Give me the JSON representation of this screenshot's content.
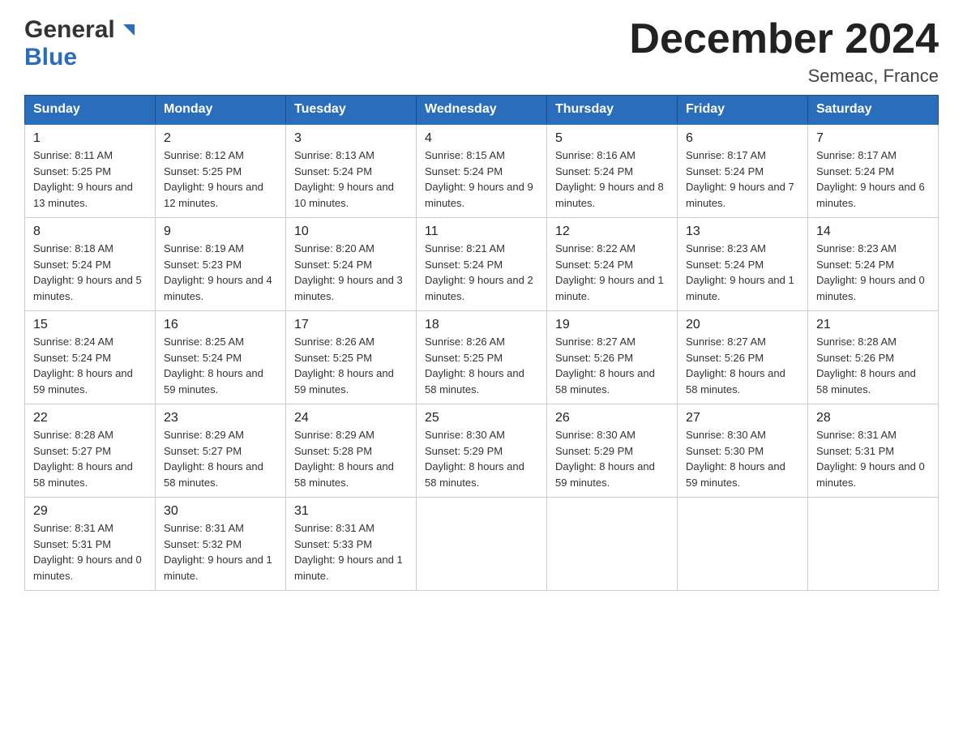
{
  "header": {
    "logo_general": "General",
    "logo_blue": "Blue",
    "month_title": "December 2024",
    "location": "Semeac, France"
  },
  "days_of_week": [
    "Sunday",
    "Monday",
    "Tuesday",
    "Wednesday",
    "Thursday",
    "Friday",
    "Saturday"
  ],
  "weeks": [
    [
      {
        "day": "1",
        "sunrise": "8:11 AM",
        "sunset": "5:25 PM",
        "daylight": "9 hours and 13 minutes."
      },
      {
        "day": "2",
        "sunrise": "8:12 AM",
        "sunset": "5:25 PM",
        "daylight": "9 hours and 12 minutes."
      },
      {
        "day": "3",
        "sunrise": "8:13 AM",
        "sunset": "5:24 PM",
        "daylight": "9 hours and 10 minutes."
      },
      {
        "day": "4",
        "sunrise": "8:15 AM",
        "sunset": "5:24 PM",
        "daylight": "9 hours and 9 minutes."
      },
      {
        "day": "5",
        "sunrise": "8:16 AM",
        "sunset": "5:24 PM",
        "daylight": "9 hours and 8 minutes."
      },
      {
        "day": "6",
        "sunrise": "8:17 AM",
        "sunset": "5:24 PM",
        "daylight": "9 hours and 7 minutes."
      },
      {
        "day": "7",
        "sunrise": "8:17 AM",
        "sunset": "5:24 PM",
        "daylight": "9 hours and 6 minutes."
      }
    ],
    [
      {
        "day": "8",
        "sunrise": "8:18 AM",
        "sunset": "5:24 PM",
        "daylight": "9 hours and 5 minutes."
      },
      {
        "day": "9",
        "sunrise": "8:19 AM",
        "sunset": "5:23 PM",
        "daylight": "9 hours and 4 minutes."
      },
      {
        "day": "10",
        "sunrise": "8:20 AM",
        "sunset": "5:24 PM",
        "daylight": "9 hours and 3 minutes."
      },
      {
        "day": "11",
        "sunrise": "8:21 AM",
        "sunset": "5:24 PM",
        "daylight": "9 hours and 2 minutes."
      },
      {
        "day": "12",
        "sunrise": "8:22 AM",
        "sunset": "5:24 PM",
        "daylight": "9 hours and 1 minute."
      },
      {
        "day": "13",
        "sunrise": "8:23 AM",
        "sunset": "5:24 PM",
        "daylight": "9 hours and 1 minute."
      },
      {
        "day": "14",
        "sunrise": "8:23 AM",
        "sunset": "5:24 PM",
        "daylight": "9 hours and 0 minutes."
      }
    ],
    [
      {
        "day": "15",
        "sunrise": "8:24 AM",
        "sunset": "5:24 PM",
        "daylight": "8 hours and 59 minutes."
      },
      {
        "day": "16",
        "sunrise": "8:25 AM",
        "sunset": "5:24 PM",
        "daylight": "8 hours and 59 minutes."
      },
      {
        "day": "17",
        "sunrise": "8:26 AM",
        "sunset": "5:25 PM",
        "daylight": "8 hours and 59 minutes."
      },
      {
        "day": "18",
        "sunrise": "8:26 AM",
        "sunset": "5:25 PM",
        "daylight": "8 hours and 58 minutes."
      },
      {
        "day": "19",
        "sunrise": "8:27 AM",
        "sunset": "5:26 PM",
        "daylight": "8 hours and 58 minutes."
      },
      {
        "day": "20",
        "sunrise": "8:27 AM",
        "sunset": "5:26 PM",
        "daylight": "8 hours and 58 minutes."
      },
      {
        "day": "21",
        "sunrise": "8:28 AM",
        "sunset": "5:26 PM",
        "daylight": "8 hours and 58 minutes."
      }
    ],
    [
      {
        "day": "22",
        "sunrise": "8:28 AM",
        "sunset": "5:27 PM",
        "daylight": "8 hours and 58 minutes."
      },
      {
        "day": "23",
        "sunrise": "8:29 AM",
        "sunset": "5:27 PM",
        "daylight": "8 hours and 58 minutes."
      },
      {
        "day": "24",
        "sunrise": "8:29 AM",
        "sunset": "5:28 PM",
        "daylight": "8 hours and 58 minutes."
      },
      {
        "day": "25",
        "sunrise": "8:30 AM",
        "sunset": "5:29 PM",
        "daylight": "8 hours and 58 minutes."
      },
      {
        "day": "26",
        "sunrise": "8:30 AM",
        "sunset": "5:29 PM",
        "daylight": "8 hours and 59 minutes."
      },
      {
        "day": "27",
        "sunrise": "8:30 AM",
        "sunset": "5:30 PM",
        "daylight": "8 hours and 59 minutes."
      },
      {
        "day": "28",
        "sunrise": "8:31 AM",
        "sunset": "5:31 PM",
        "daylight": "9 hours and 0 minutes."
      }
    ],
    [
      {
        "day": "29",
        "sunrise": "8:31 AM",
        "sunset": "5:31 PM",
        "daylight": "9 hours and 0 minutes."
      },
      {
        "day": "30",
        "sunrise": "8:31 AM",
        "sunset": "5:32 PM",
        "daylight": "9 hours and 1 minute."
      },
      {
        "day": "31",
        "sunrise": "8:31 AM",
        "sunset": "5:33 PM",
        "daylight": "9 hours and 1 minute."
      },
      null,
      null,
      null,
      null
    ]
  ],
  "labels": {
    "sunrise": "Sunrise:",
    "sunset": "Sunset:",
    "daylight": "Daylight:"
  }
}
